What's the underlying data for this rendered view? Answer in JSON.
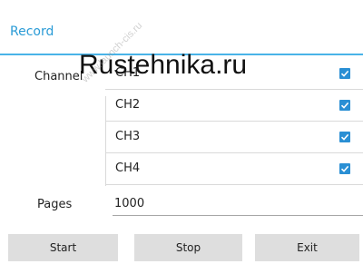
{
  "dialog": {
    "title": "Record"
  },
  "channel": {
    "label": "Channel",
    "items": [
      {
        "label": "CH1",
        "checked": true
      },
      {
        "label": "CH2",
        "checked": true
      },
      {
        "label": "CH3",
        "checked": true
      },
      {
        "label": "CH4",
        "checked": true
      }
    ]
  },
  "pages": {
    "label": "Pages",
    "value": "1000"
  },
  "buttons": {
    "start": "Start",
    "stop": "Stop",
    "exit": "Exit"
  },
  "watermark": {
    "main": "Rustehnika.ru",
    "diagonal": "www.launch-cis.ru"
  },
  "colors": {
    "accent": "#2a9bd6",
    "divider": "#49b3e8",
    "checkbox": "#2a8fd4",
    "button": "#dedede"
  }
}
